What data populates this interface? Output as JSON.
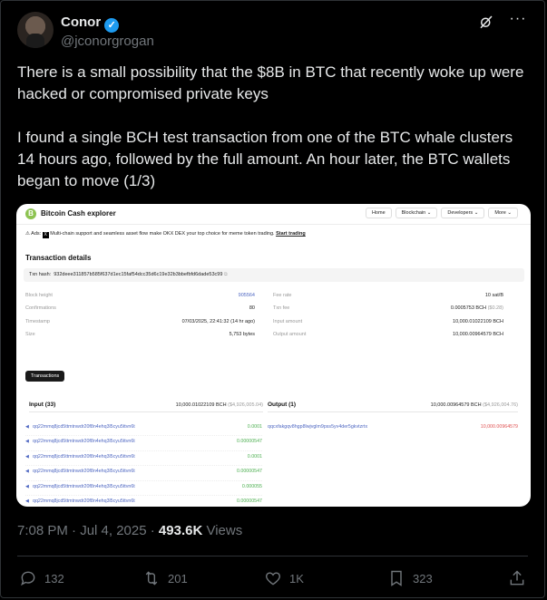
{
  "author": {
    "name": "Conor",
    "handle": "@jconorgrogan",
    "verified_badge": "✓"
  },
  "tweet_text": [
    "There is a small possibility that the $8B in BTC that recently woke up were hacked or compromised private keys",
    "I found a single BCH test transaction from one of the BTC whale clusters 14 hours ago, followed by the full amount. An hour later, the BTC wallets began to move (1/3)"
  ],
  "screenshot": {
    "brand": "Bitcoin Cash explorer",
    "logo_glyph": "B",
    "nav": [
      "Home",
      "Blockchain ⌄",
      "Developers ⌄",
      "More ⌄"
    ],
    "ads_label": "Ads:",
    "ads_icon": "x-logo",
    "ads_text": "Multi-chain support and seamless asset flow make OKX DEX your top choice for meme token trading.",
    "ads_link": "Start trading",
    "section_title": "Transaction details",
    "tx_hash_label": "Txn hash:",
    "tx_hash": "932deee311857b585f637d1ec15faf54dcc35d6c19e32b3bbefbfd6dade53c99",
    "left_details": [
      {
        "label": "Block height",
        "value": "905564"
      },
      {
        "label": "Confirmations",
        "value": "80"
      },
      {
        "label": "Timestamp",
        "value": "07/03/2025, 22:41:32 (14 hr ago)"
      },
      {
        "label": "Size",
        "value": "5,753 bytes"
      }
    ],
    "right_details": [
      {
        "label": "Fee rate",
        "value": "10 sat/B"
      },
      {
        "label": "Txn fee",
        "value": "0.0005753 BCH",
        "sub": "($0.28)"
      },
      {
        "label": "Input amount",
        "value": "10,000.01022109 BCH"
      },
      {
        "label": "Output amount",
        "value": "10,000.00964579 BCH"
      }
    ],
    "transactions_button": "Transactions",
    "input_header": "Input (33)",
    "input_amount": "10,000.01022109 BCH",
    "input_amount_usd": "($4,926,005.04)",
    "output_header": "Output (1)",
    "output_amount": "10,000.00964579 BCH",
    "output_amount_usd": "($4,926,004.76)",
    "inputs": [
      {
        "address": "qq22mmq8jcd5ttmtnwdr20f8n4ehq3l5cyu5ttvn6t",
        "value": "0.0001"
      },
      {
        "address": "qq22mmq8jcd5ttmtnwdr20f8n4ehq3l5cyu5ttvn6t",
        "value": "0.00000547"
      },
      {
        "address": "qq22mmq8jcd5ttmtnwdr20f8n4ehq3l5cyu5ttvn6t",
        "value": "0.0001"
      },
      {
        "address": "qq22mmq8jcd5ttmtnwdr20f8n4ehq3l5cyu5ttvn6t",
        "value": "0.00000547"
      },
      {
        "address": "qq22mmq8jcd5ttmtnwdr20f8n4ehq3l5cyu5ttvn6t",
        "value": "0.000055"
      },
      {
        "address": "qq22mmq8jcd5ttmtnwdr20f8n4ehq3l5cyu5ttvn6t",
        "value": "0.00000547"
      }
    ],
    "output": {
      "address": "qqcxfakgqv8hgp8lwjvglm9pss5yv4der5gkvtzrtx",
      "value": "10,000.00964579"
    }
  },
  "meta": {
    "time": "7:08 PM · Jul 4, 2025 · ",
    "views_count": "493.6K",
    "views_label": " Views"
  },
  "actions": {
    "replies": "132",
    "reposts": "201",
    "likes": "1K",
    "bookmarks": "323"
  },
  "icons": {
    "grok": "grok-icon",
    "more": "more-icon",
    "reply": "reply-icon",
    "repost": "repost-icon",
    "like": "like-icon",
    "bookmark": "bookmark-icon",
    "share": "share-icon"
  },
  "colors": {
    "accent": "#1d9bf0",
    "muted": "#71767b",
    "bch_green": "#8dc351"
  }
}
